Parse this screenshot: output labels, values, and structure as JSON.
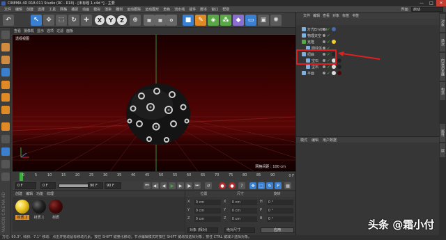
{
  "window": {
    "title": "CINEMA 4D R18.011 Studio (RC - R18) - [未标题 1.c4d *] - 主要",
    "minimize": "—",
    "maximize": "□",
    "close": "✕"
  },
  "menubar": {
    "items": [
      "文件",
      "编辑",
      "创建",
      "选择",
      "工具",
      "网格",
      "捕捉",
      "动画",
      "模拟",
      "渲染",
      "雕刻",
      "运动跟踪",
      "运动图形",
      "角色",
      "流水线",
      "插件",
      "脚本",
      "窗口",
      "帮助"
    ],
    "layout_label": "界面:",
    "layout_value": "启动"
  },
  "toolbar": {
    "axis_x": "X",
    "axis_y": "Y",
    "axis_z": "Z"
  },
  "viewport": {
    "menu": [
      "查看",
      "摄像机",
      "显示",
      "选项",
      "过滤",
      "面板"
    ],
    "label": "透视视图",
    "grid_spacing": "网格间距 : 100 cm"
  },
  "timeline": {
    "ticks": [
      "0",
      "5",
      "10",
      "15",
      "20",
      "25",
      "30",
      "35",
      "40",
      "45",
      "50",
      "55",
      "60",
      "65",
      "70",
      "75",
      "80",
      "85",
      "90"
    ],
    "end_frame_label": "0 F"
  },
  "transport": {
    "current": "0 F",
    "start": "0 F",
    "end": "90 F",
    "max": "90 F",
    "slider_label": "90 F"
  },
  "materials": {
    "menu": [
      "创建",
      "编辑",
      "功能",
      "纹理"
    ],
    "items": [
      {
        "name": "材质.2",
        "color": "#f2cc2a",
        "selected": true
      },
      {
        "name": "材质.1",
        "color": "#222222",
        "selected": false
      },
      {
        "name": "材质",
        "color": "#4a0a0a",
        "selected": false
      }
    ]
  },
  "coordinates": {
    "headers": [
      "位置",
      "尺寸",
      "旋转"
    ],
    "rows": [
      {
        "a": "X",
        "av": "0 cm",
        "b": "X",
        "bv": "0 cm",
        "c": "H",
        "cv": "0 °"
      },
      {
        "a": "Y",
        "av": "0 cm",
        "b": "Y",
        "bv": "0 cm",
        "c": "P",
        "cv": "0 °"
      },
      {
        "a": "Z",
        "av": "0 cm",
        "b": "Z",
        "bv": "0 cm",
        "c": "B",
        "cv": "0 °"
      }
    ],
    "mode_select": "对象 (相对)",
    "size_select": "绝对尺寸",
    "apply": "应用"
  },
  "status": {
    "text": "方位: 90.3°, 倾斜: -7.1° 移动：点击并拖动鼠标移动元素。按住 SHIFT 键量化移动；节点编辑模式时按住 SHIFT 键增加选择对象；按住 CTRL 键减少选择对象。"
  },
  "object_manager": {
    "menu": [
      "文件",
      "编辑",
      "查看",
      "对象",
      "标签",
      "书签"
    ],
    "objects": [
      {
        "name": "灯光Emitter",
        "indent": 0,
        "icon": "#7fb0e0"
      },
      {
        "name": "物理天空",
        "indent": 0,
        "icon": "#7fb0e0"
      },
      {
        "name": "克隆",
        "indent": 0,
        "icon": "#5aa845"
      },
      {
        "name": "圆柱体",
        "indent": 1,
        "icon": "#7fb0e0"
      },
      {
        "name": "扭曲",
        "indent": 0,
        "icon": "#7fb0e0"
      },
      {
        "name": "宝石",
        "indent": 1,
        "icon": "#7fb0e0"
      },
      {
        "name": "宝石",
        "indent": 1,
        "icon": "#7fb0e0"
      },
      {
        "name": "平面",
        "indent": 0,
        "icon": "#7fb0e0"
      }
    ]
  },
  "attributes": {
    "menu": [
      "模式",
      "编辑",
      "用户数据"
    ]
  },
  "side_tabs": [
    "对象",
    "场次",
    "内容浏览器",
    "构造",
    "属性",
    "层"
  ],
  "watermark": "头条 @霜小付",
  "colors": {
    "accent_orange": "#e08a25",
    "highlight_red": "#e02020",
    "active_green": "#3faf3f"
  }
}
